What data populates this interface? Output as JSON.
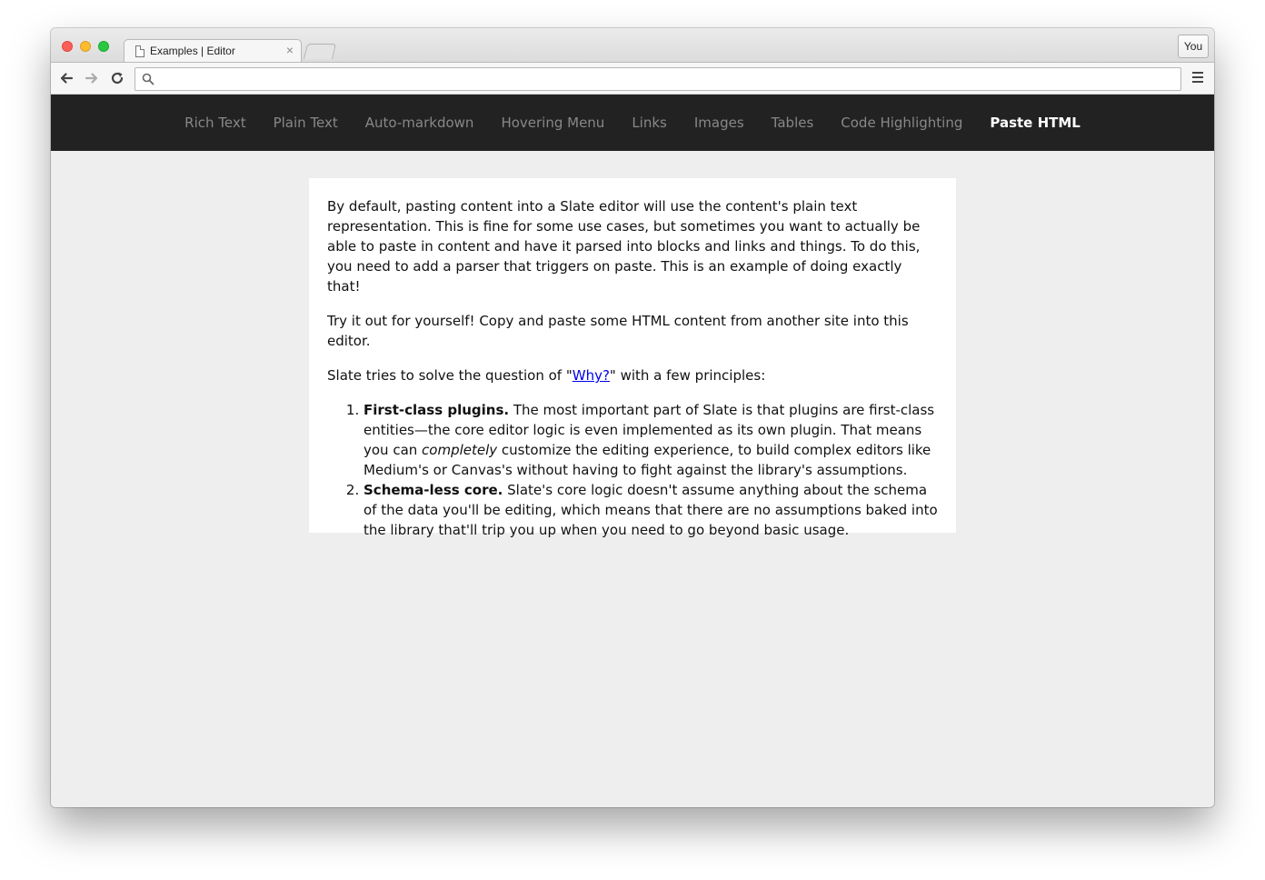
{
  "browser": {
    "tab_title": "Examples | Editor",
    "tab_close": "×",
    "profile_label": "You",
    "address_value": "",
    "address_placeholder": ""
  },
  "site_nav": {
    "items": [
      {
        "label": "Rich Text",
        "active": false
      },
      {
        "label": "Plain Text",
        "active": false
      },
      {
        "label": "Auto-markdown",
        "active": false
      },
      {
        "label": "Hovering Menu",
        "active": false
      },
      {
        "label": "Links",
        "active": false
      },
      {
        "label": "Images",
        "active": false
      },
      {
        "label": "Tables",
        "active": false
      },
      {
        "label": "Code Highlighting",
        "active": false
      },
      {
        "label": "Paste HTML",
        "active": true
      }
    ]
  },
  "editor": {
    "p1": "By default, pasting content into a Slate editor will use the content's plain text representation. This is fine for some use cases, but sometimes you want to actually be able to paste in content and have it parsed into blocks and links and things. To do this, you need to add a parser that triggers on paste. This is an example of doing exactly that!",
    "p2": "Try it out for yourself! Copy and paste some HTML content from another site into this editor.",
    "p3_before": "Slate tries to solve the question of \"",
    "p3_link": "Why?",
    "p3_after": "\" with a few principles:",
    "list": [
      {
        "bold": "First-class plugins.",
        "text_before": " The most important part of Slate is that plugins are first-class entities—the core editor logic is even implemented as its own plugin. That means you can ",
        "italic": "completely",
        "text_after": " customize the editing experience, to build complex editors like Medium's or Canvas's without having to fight against the library's assumptions."
      },
      {
        "bold": "Schema-less core.",
        "text_before": " Slate's core logic doesn't assume anything about the schema of the data you'll be editing, which means that there are no assumptions baked into the library that'll trip you up when you need to go beyond basic usage.",
        "italic": "",
        "text_after": ""
      }
    ]
  },
  "colors": {
    "nav_bg": "#222222",
    "nav_link": "#888888",
    "nav_active": "#ffffff",
    "page_bg": "#eeeeee",
    "link": "#0000ee"
  },
  "icons": [
    "back-arrow-icon",
    "forward-arrow-icon",
    "reload-icon",
    "search-icon",
    "menu-icon",
    "page-icon",
    "close-icon"
  ]
}
